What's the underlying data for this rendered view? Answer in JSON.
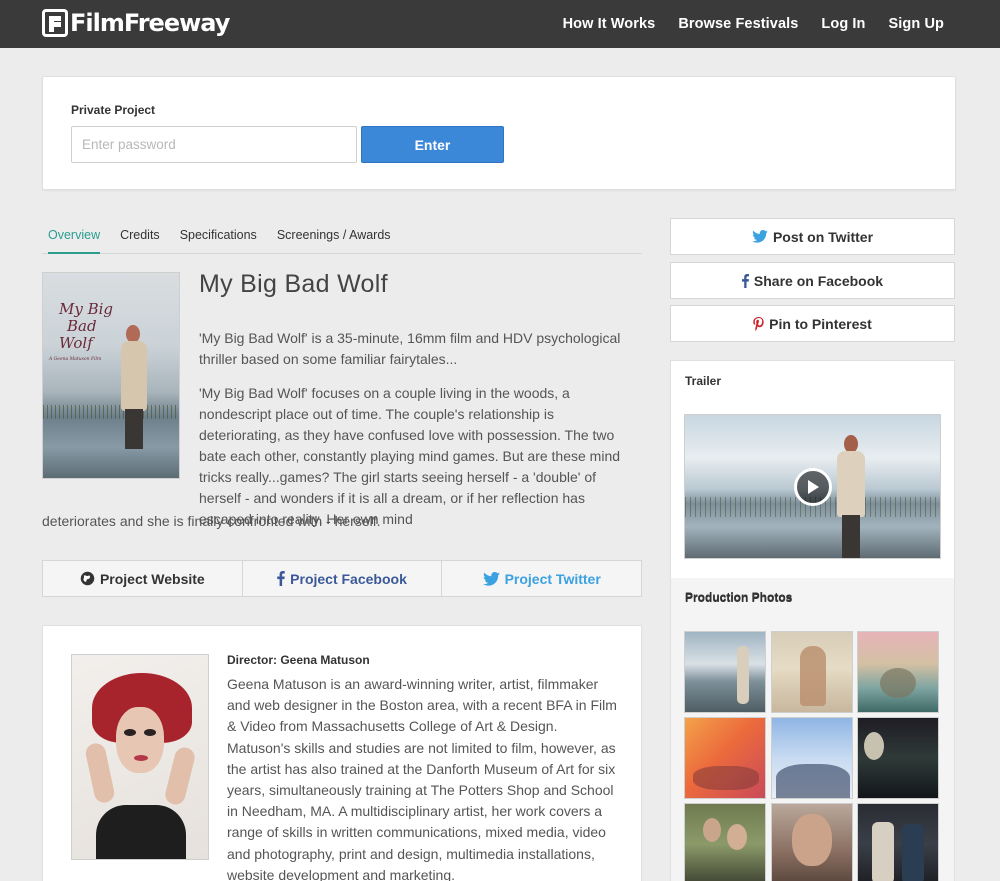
{
  "header": {
    "logo_text": "FilmFreeway",
    "nav": [
      "How It Works",
      "Browse Festivals",
      "Log In",
      "Sign Up"
    ]
  },
  "private_project": {
    "label": "Private Project",
    "password_placeholder": "Enter password",
    "enter_label": "Enter"
  },
  "tabs": [
    {
      "label": "Overview",
      "active": true
    },
    {
      "label": "Credits",
      "active": false
    },
    {
      "label": "Specifications",
      "active": false
    },
    {
      "label": "Screenings / Awards",
      "active": false
    }
  ],
  "poster": {
    "title_lines": [
      "My Big",
      "Bad",
      "Wolf"
    ],
    "subtitle": "A Geena Matuson Film"
  },
  "film": {
    "title": "My Big Bad Wolf",
    "description_1": "'My Big Bad Wolf' is a 35-minute, 16mm film and HDV psychological thriller based on some familiar fairytales...",
    "description_2": "'My Big Bad Wolf' focuses on a couple living in the woods, a nondescript place out of time. The couple's relationship is deteriorating, as they have confused love with possession. The two bate each other, constantly playing mind games. But are these mind tricks really...games? The girl starts seeing herself - a 'double' of herself - and wonders if it is all a dream, or if her reflection has escaped into reality. Her own mind",
    "description_2_cont": "deteriorates and she is finally confronted with - herself."
  },
  "project_links": {
    "website": "Project Website",
    "facebook": "Project Facebook",
    "twitter": "Project Twitter"
  },
  "director": {
    "label": "Director: Geena Matuson",
    "bio": "Geena Matuson is an award-winning writer, artist, filmmaker and web designer in the Boston area, with a recent BFA in Film & Video from Massachusetts College of Art & Design. Matuson's skills and studies are not limited to film, however, as the artist has also trained at the Danforth Museum of Art for six years, simultaneously training at The Potters Shop and School in Needham, MA. A multidisciplinary artist, her work covers a range of skills in written communications, mixed media, video and photography, print and design, multimedia installations, website development and marketing."
  },
  "share": {
    "twitter": "Post on Twitter",
    "facebook": "Share on Facebook",
    "pinterest": "Pin to Pinterest"
  },
  "sidebar": {
    "trailer_label": "Trailer",
    "photos_label": "Production Photos"
  },
  "colors": {
    "topbar": "#3a3a3a",
    "accent_teal": "#2a9d8f",
    "button_blue": "#3b87d8",
    "facebook_blue": "#3b5998",
    "twitter_blue": "#3ba1e0",
    "pinterest_red": "#cb2027"
  }
}
